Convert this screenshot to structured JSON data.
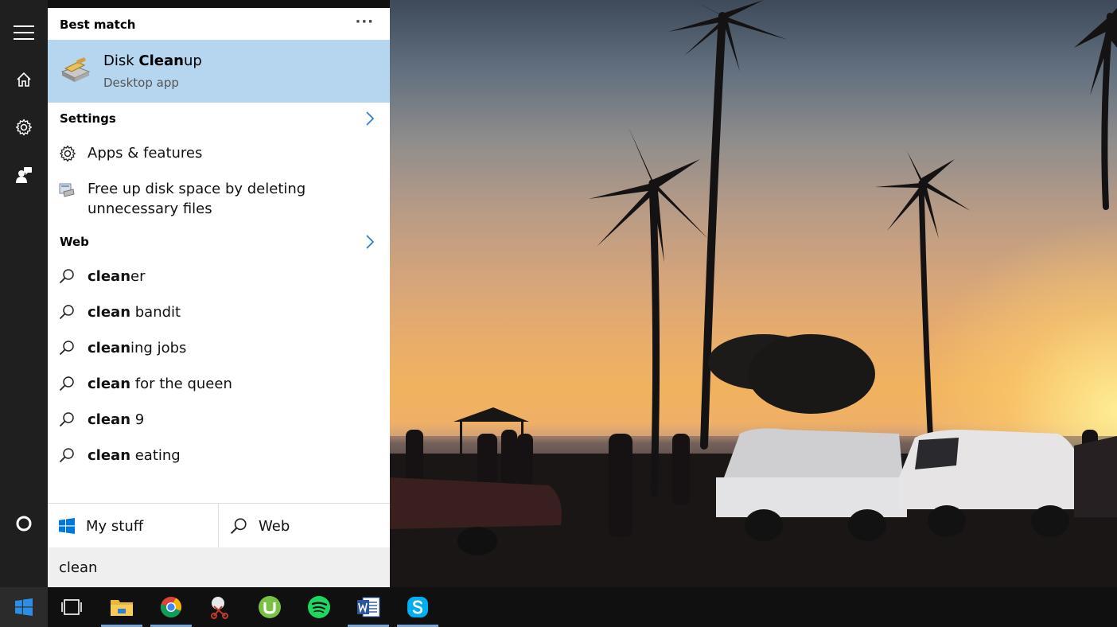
{
  "panel": {
    "best_match_header": "Best match",
    "more_options_glyph": "···",
    "best_match": {
      "title_pre": "Disk ",
      "title_bold": "Clean",
      "title_post": "up",
      "subtitle": "Desktop app",
      "icon": "disk-cleanup-icon"
    },
    "settings_header": "Settings",
    "settings_items": [
      {
        "label": "Apps & features",
        "icon": "gear-icon"
      },
      {
        "label": "Free up disk space by deleting unnecessary files",
        "icon": "disk-cleanup-small-icon"
      }
    ],
    "web_header": "Web",
    "web_items": [
      {
        "bold": "clean",
        "rest": "er"
      },
      {
        "bold": "clean",
        "rest": " bandit"
      },
      {
        "bold": "clean",
        "rest": "ing jobs"
      },
      {
        "bold": "clean",
        "rest": " for the queen"
      },
      {
        "bold": "clean",
        "rest": " 9"
      },
      {
        "bold": "clean",
        "rest": " eating"
      }
    ],
    "scope": {
      "my_stuff": "My stuff",
      "web": "Web"
    },
    "search": {
      "value": "clean"
    }
  },
  "rail": {
    "items": [
      "hamburger-menu-icon",
      "home-icon",
      "settings-gear-icon",
      "feedback-icon",
      "cortana-circle-icon"
    ]
  },
  "taskbar": {
    "items": [
      "start",
      "task-view",
      "file-explorer",
      "chrome",
      "snipping-tool",
      "utorrent",
      "spotify",
      "word",
      "skype"
    ]
  },
  "colors": {
    "highlight": "#b6d5ee",
    "accent": "#0078d7",
    "panel_bg": "#ffffff",
    "rail_bg": "#1f1f1f",
    "taskbar_bg": "#101010"
  }
}
